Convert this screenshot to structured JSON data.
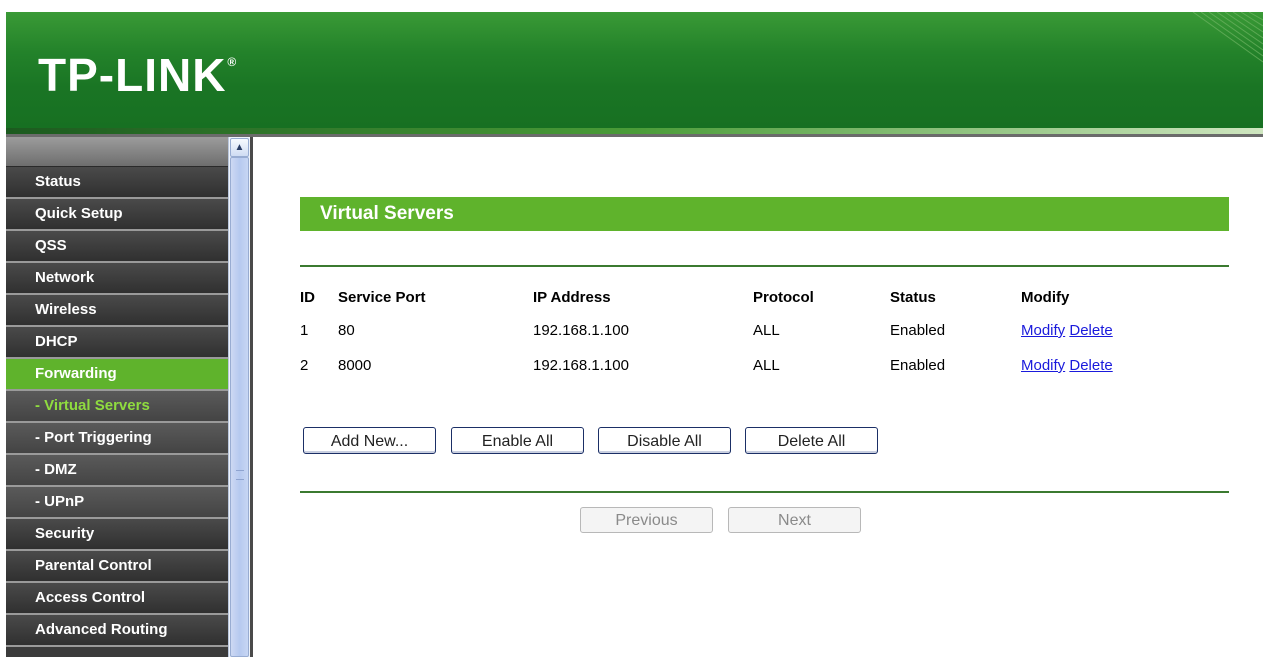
{
  "header": {
    "logo_text": "TP-LINK",
    "logo_registered": "®"
  },
  "sidebar": {
    "items": [
      {
        "label": "Status",
        "type": "main",
        "state": "normal"
      },
      {
        "label": "Quick Setup",
        "type": "main",
        "state": "normal"
      },
      {
        "label": "QSS",
        "type": "main",
        "state": "normal"
      },
      {
        "label": "Network",
        "type": "main",
        "state": "normal"
      },
      {
        "label": "Wireless",
        "type": "main",
        "state": "normal"
      },
      {
        "label": "DHCP",
        "type": "main",
        "state": "normal"
      },
      {
        "label": "Forwarding",
        "type": "main",
        "state": "active"
      },
      {
        "label": "- Virtual Servers",
        "type": "sub",
        "state": "selected"
      },
      {
        "label": "- Port Triggering",
        "type": "sub",
        "state": "normal"
      },
      {
        "label": "- DMZ",
        "type": "sub",
        "state": "normal"
      },
      {
        "label": "- UPnP",
        "type": "sub",
        "state": "normal"
      },
      {
        "label": "Security",
        "type": "main",
        "state": "normal"
      },
      {
        "label": "Parental Control",
        "type": "main",
        "state": "normal"
      },
      {
        "label": "Access Control",
        "type": "main",
        "state": "normal"
      },
      {
        "label": "Advanced Routing",
        "type": "main",
        "state": "normal"
      }
    ]
  },
  "main": {
    "title": "Virtual Servers",
    "table": {
      "headers": [
        "ID",
        "Service Port",
        "IP Address",
        "Protocol",
        "Status",
        "Modify"
      ],
      "rows": [
        {
          "id": "1",
          "service_port": "80",
          "ip_address": "192.168.1.100",
          "protocol": "ALL",
          "status": "Enabled",
          "modify_label": "Modify",
          "delete_label": "Delete"
        },
        {
          "id": "2",
          "service_port": "8000",
          "ip_address": "192.168.1.100",
          "protocol": "ALL",
          "status": "Enabled",
          "modify_label": "Modify",
          "delete_label": "Delete"
        }
      ]
    },
    "buttons": {
      "add_new": "Add New...",
      "enable_all": "Enable All",
      "disable_all": "Disable All",
      "delete_all": "Delete All"
    },
    "pagination": {
      "previous": "Previous",
      "next": "Next"
    }
  },
  "colors": {
    "brand_green": "#5fb32c",
    "header_green": "#1a7524",
    "link_blue": "#1a1adc"
  }
}
